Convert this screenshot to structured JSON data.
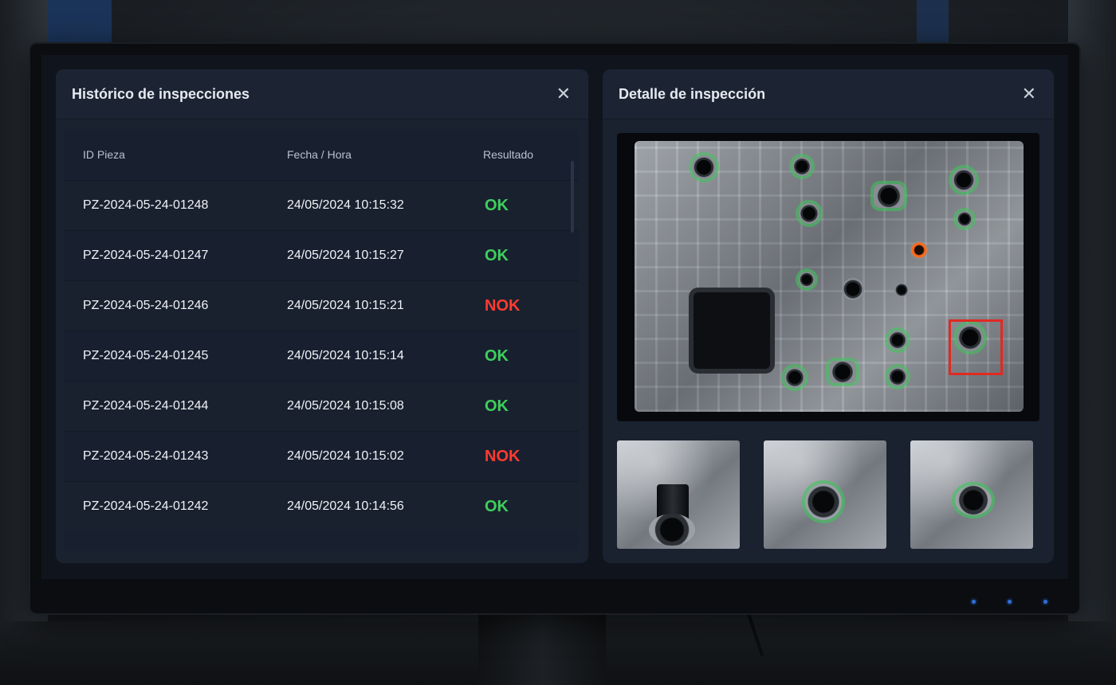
{
  "history": {
    "title": "Histórico de inspecciones",
    "close_symbol": "✕",
    "columns": {
      "id": "ID Pieza",
      "date": "Fecha / Hora",
      "result": "Resultado"
    },
    "rows": [
      {
        "id": "PZ-2024-05-24-01248",
        "date": "24/05/2024 10:15:32",
        "result": "OK",
        "status": "ok"
      },
      {
        "id": "PZ-2024-05-24-01247",
        "date": "24/05/2024 10:15:27",
        "result": "OK",
        "status": "ok"
      },
      {
        "id": "PZ-2024-05-24-01246",
        "date": "24/05/2024 10:15:21",
        "result": "NOK",
        "status": "nok"
      },
      {
        "id": "PZ-2024-05-24-01245",
        "date": "24/05/2024 10:15:14",
        "result": "OK",
        "status": "ok"
      },
      {
        "id": "PZ-2024-05-24-01244",
        "date": "24/05/2024 10:15:08",
        "result": "OK",
        "status": "ok"
      },
      {
        "id": "PZ-2024-05-24-01243",
        "date": "24/05/2024 10:15:02",
        "result": "NOK",
        "status": "nok"
      },
      {
        "id": "PZ-2024-05-24-01242",
        "date": "24/05/2024 10:14:56",
        "result": "OK",
        "status": "ok"
      }
    ]
  },
  "detail": {
    "title": "Detalle de inspección",
    "close_symbol": "✕"
  },
  "colors": {
    "ok": "#3ecf5c",
    "nok": "#ff3b30",
    "panel": "#1a2230",
    "accent_led": "#2f6fd6"
  },
  "icons": {
    "close": "close-icon"
  }
}
